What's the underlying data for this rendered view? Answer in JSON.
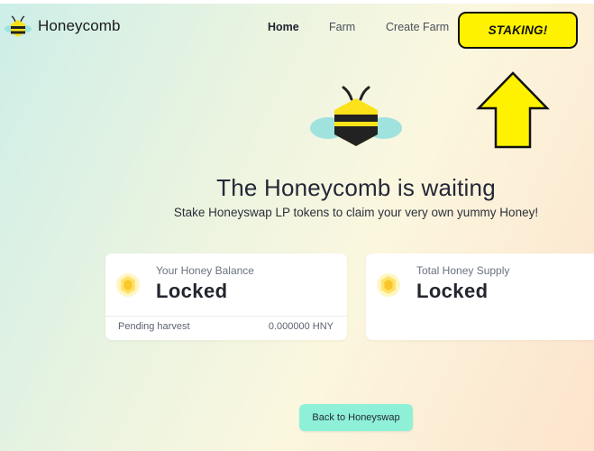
{
  "brand": {
    "name": "Honeycomb",
    "logo_icon": "bee-icon"
  },
  "nav": {
    "items": [
      {
        "label": "Home",
        "active": true
      },
      {
        "label": "Farm",
        "active": false
      },
      {
        "label": "Create Farm",
        "active": false
      }
    ],
    "staking_label": "STAKING!"
  },
  "annotation": {
    "icon": "arrow-up-icon",
    "color": "#fff200"
  },
  "hero": {
    "icon": "bee-icon",
    "title": "The Honeycomb is waiting",
    "subtitle": "Stake Honeyswap LP tokens to claim your very own yummy Honey!"
  },
  "cards": [
    {
      "icon": "honeycomb-icon",
      "label": "Your Honey Balance",
      "value": "Locked",
      "footer_label": "Pending harvest",
      "footer_value": "0.000000 HNY"
    },
    {
      "icon": "honeycomb-icon",
      "label": "Total Honey Supply",
      "value": "Locked"
    }
  ],
  "back_button": {
    "label": "Back to Honeyswap"
  },
  "colors": {
    "accent_yellow": "#fff200",
    "bee_yellow": "#fbe21a",
    "bee_wing": "#9fe2de",
    "button_mint": "#8ff0d8"
  }
}
